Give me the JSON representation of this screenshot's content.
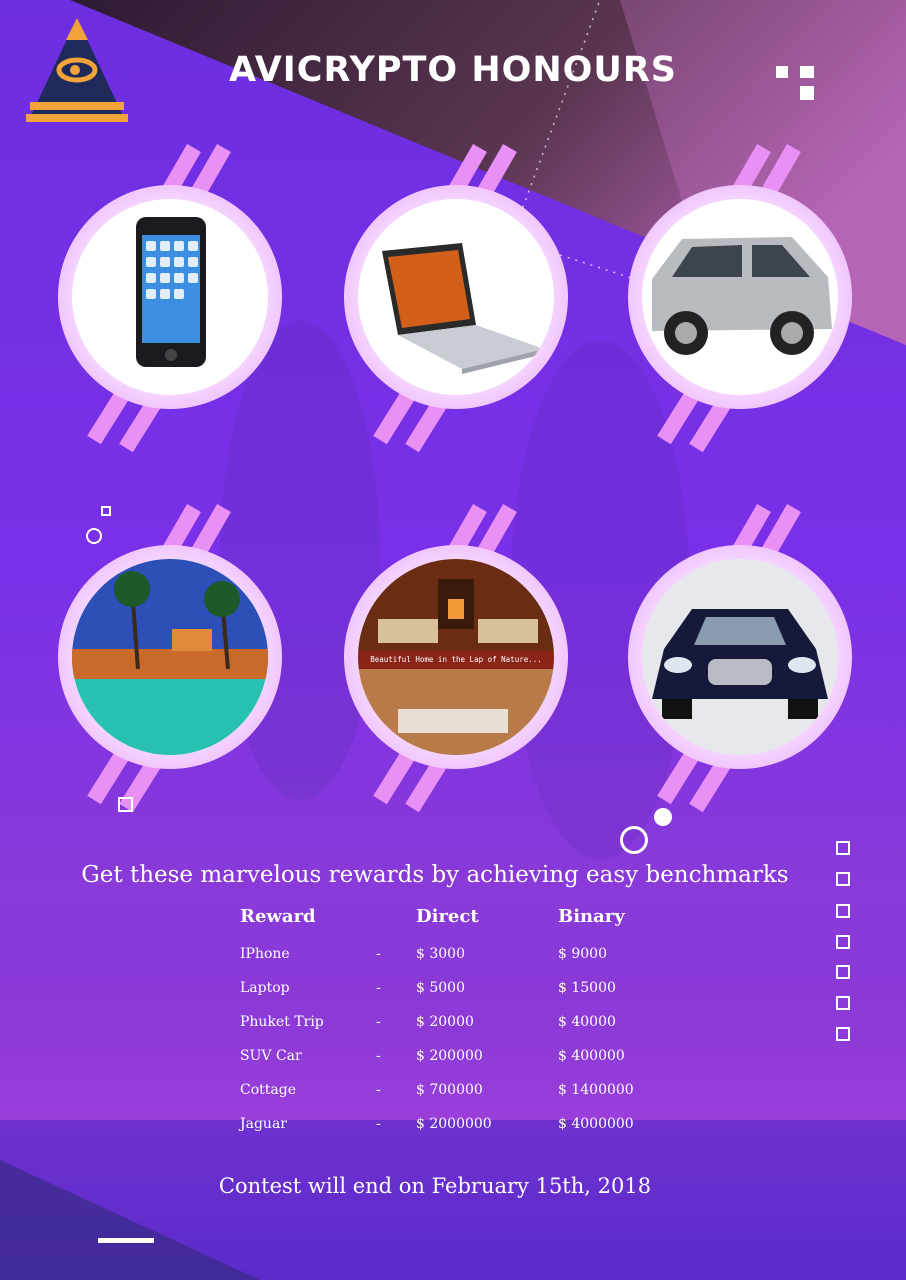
{
  "header": {
    "title": "AVICRYPTO HONOURS",
    "logo_icon": "pyramid-eye-logo-icon"
  },
  "prizes": [
    {
      "name": "IPhone",
      "icon": "smartphone-icon"
    },
    {
      "name": "Laptop",
      "icon": "laptop-icon"
    },
    {
      "name": "SUV Car",
      "icon": "suv-icon"
    },
    {
      "name": "Phuket Trip",
      "icon": "resort-icon"
    },
    {
      "name": "Cottage",
      "icon": "cottage-interior-icon",
      "caption": "Beautiful Home in the Lap of Nature..."
    },
    {
      "name": "Jaguar",
      "icon": "sports-car-icon"
    }
  ],
  "tagline": "Get these marvelous rewards by achieving easy benchmarks",
  "table": {
    "headers": [
      "Reward",
      "Direct",
      "Binary"
    ],
    "rows": [
      {
        "reward": "IPhone",
        "sep": "-",
        "direct": "$ 3000",
        "binary": "$ 9000"
      },
      {
        "reward": "Laptop",
        "sep": "-",
        "direct": "$ 5000",
        "binary": "$ 15000"
      },
      {
        "reward": "Phuket Trip",
        "sep": "-",
        "direct": "$ 20000",
        "binary": "$ 40000"
      },
      {
        "reward": "SUV Car",
        "sep": "-",
        "direct": "$ 200000",
        "binary": "$ 400000"
      },
      {
        "reward": "Cottage",
        "sep": "-",
        "direct": "$ 700000",
        "binary": "$ 1400000"
      },
      {
        "reward": "Jaguar",
        "sep": "-",
        "direct": "$ 2000000",
        "binary": "$ 4000000"
      }
    ]
  },
  "footer": "Contest will end on February 15th, 2018",
  "colors": {
    "background": "#7a30e8",
    "dark_band": "#3a1f3f",
    "ring_pink": "#e59cf7",
    "accent_orange": "#f2a33a"
  }
}
